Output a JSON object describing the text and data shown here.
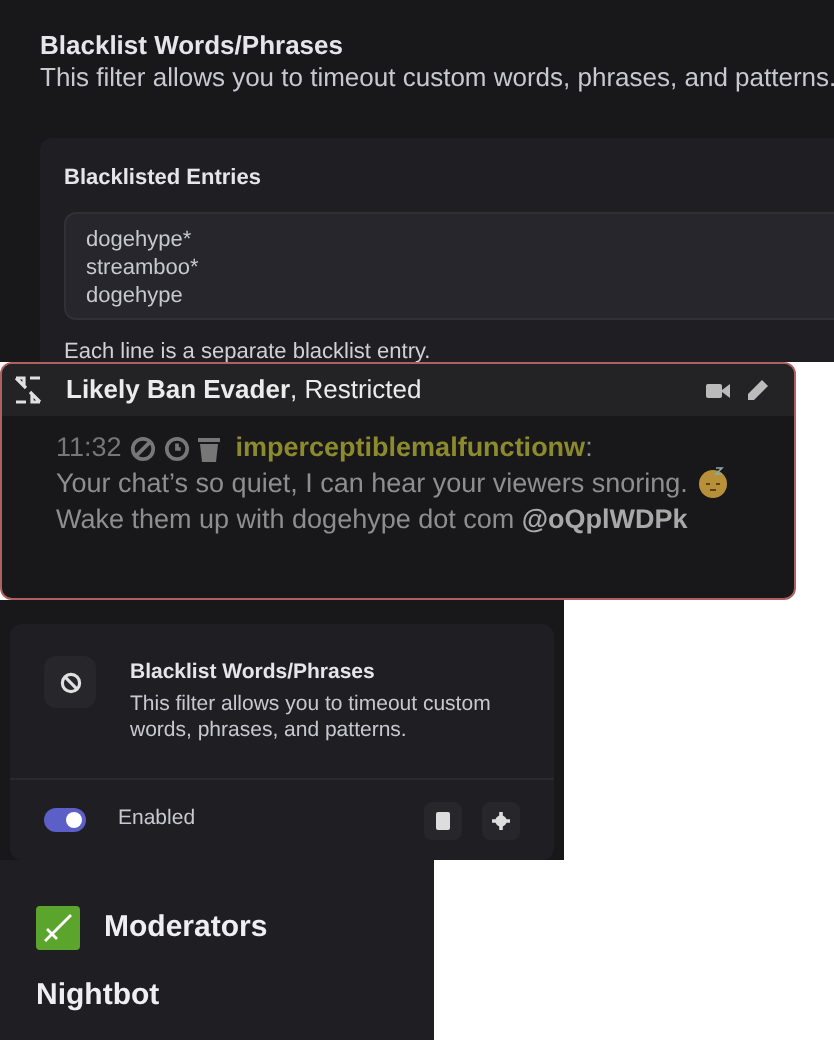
{
  "filter_settings": {
    "title": "Blacklist Words/Phrases",
    "description": "This filter allows you to timeout custom words, phrases, and patterns.",
    "entries_label": "Blacklisted Entries",
    "entries": [
      "dogehype*",
      "streamboo*",
      "dogehype"
    ],
    "hint": "Each line is a separate blacklist entry."
  },
  "chat_card": {
    "title": "Likely Ban Evader",
    "subtitle": ", Restricted",
    "time": "11:32",
    "username": "imperceptiblemalfunctionw",
    "separator": ":",
    "text_before": "Your chat’s so quiet, I can hear your viewers snoring.",
    "text_after": "Wake them up with dogehype dot com",
    "mention": "@oQplWDPk"
  },
  "filter_card": {
    "title": "Blacklist Words/Phrases",
    "description": "This filter allows you to timeout custom words, phrases, and patterns.",
    "enabled": true,
    "status_label": "Enabled"
  },
  "moderators": {
    "heading": "Moderators",
    "members": [
      "Nightbot"
    ]
  }
}
